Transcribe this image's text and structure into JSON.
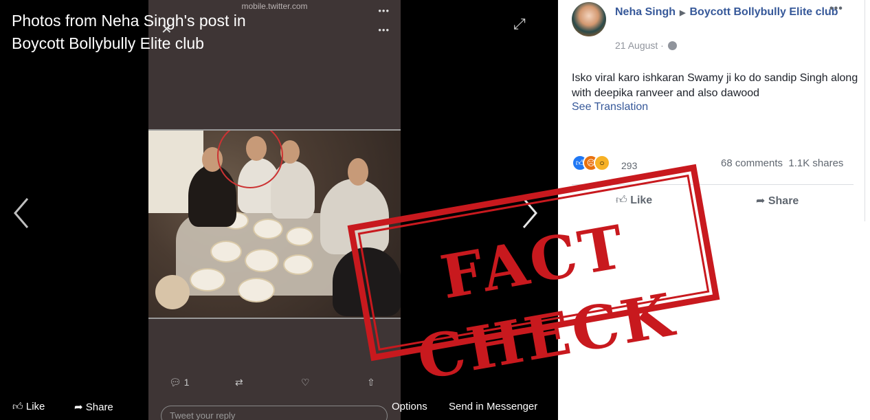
{
  "viewer": {
    "title": "Photos from Neha Singh's post in Boycott Bollybully Elite club",
    "footer": {
      "like_label": "Like",
      "share_label": "Share",
      "options_label": "Options",
      "send_label": "Send in Messenger"
    }
  },
  "screenshot": {
    "url": "mobile.twitter.com",
    "reply_count": "1",
    "reply_placeholder": "Tweet your reply"
  },
  "post": {
    "author": "Neha Singh",
    "group": "Boycott Bollybully Elite club",
    "date": "21 August",
    "text": "Isko viral karo ishkaran Swamy ji ko do sandip Singh along with deepika ranveer and also dawood",
    "see_translation": "See Translation",
    "reaction_count": "293",
    "comments": "68 comments",
    "shares": "1.1K shares",
    "like_label": "Like",
    "share_label": "Share"
  },
  "stamp": {
    "text": "FACT CHECK",
    "color": "#c8191e"
  },
  "colors": {
    "link": "#365899",
    "muted": "#606770"
  }
}
